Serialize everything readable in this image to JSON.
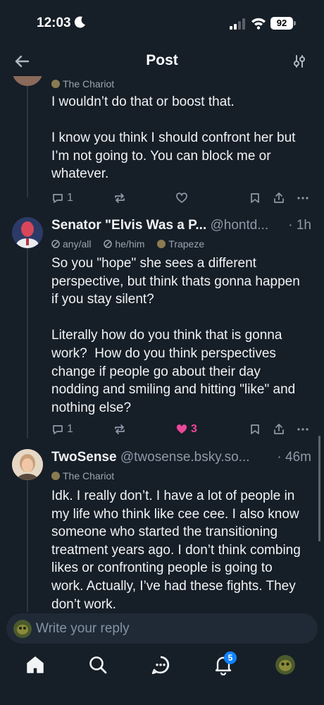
{
  "status": {
    "time": "12:03",
    "battery": "92"
  },
  "header": {
    "title": "Post"
  },
  "posts": [
    {
      "author_label": "The Chariot",
      "text": "I wouldn’t do that or boost that.\n\nI know you think I should confront her but I’m not going to. You can block me or whatever.",
      "reply_count": "1"
    },
    {
      "display_name": "Senator \"Elvis Was a P...",
      "handle": "@hontd...",
      "age": "· 1h",
      "labels": [
        "any/all",
        "he/him",
        "Trapeze"
      ],
      "text": "So you \"hope\" she sees a different perspective, but think thats gonna happen if you stay silent?\n\nLiterally how do you think that is gonna work?  How do you think perspectives change if people go about their day nodding and smiling and hitting \"like\" and nothing else?",
      "reply_count": "1",
      "like_count": "3"
    },
    {
      "display_name": "TwoSense",
      "handle": "@twosense.bsky.so...",
      "age": "· 46m",
      "author_label": "The Chariot",
      "text": "Idk. I really don’t. I have a lot of people in my life who think like cee cee. I also know someone who started the transitioning treatment years ago. I don’t think combing likes or confronting people is going to work. Actually, I’ve had these fights. They don’t work."
    }
  ],
  "reply": {
    "placeholder": "Write your reply"
  },
  "nav": {
    "notifications_badge": "5"
  },
  "colors": {
    "background": "#161e27",
    "like": "#ec4899",
    "badge": "#1083fe",
    "muted": "#8e9aa8"
  },
  "icons": [
    "back-arrow-icon",
    "sliders-icon",
    "reply-icon",
    "repost-icon",
    "heart-icon",
    "bookmark-icon",
    "share-icon",
    "more-icon",
    "home-icon",
    "search-icon",
    "chat-icon",
    "bell-icon"
  ]
}
